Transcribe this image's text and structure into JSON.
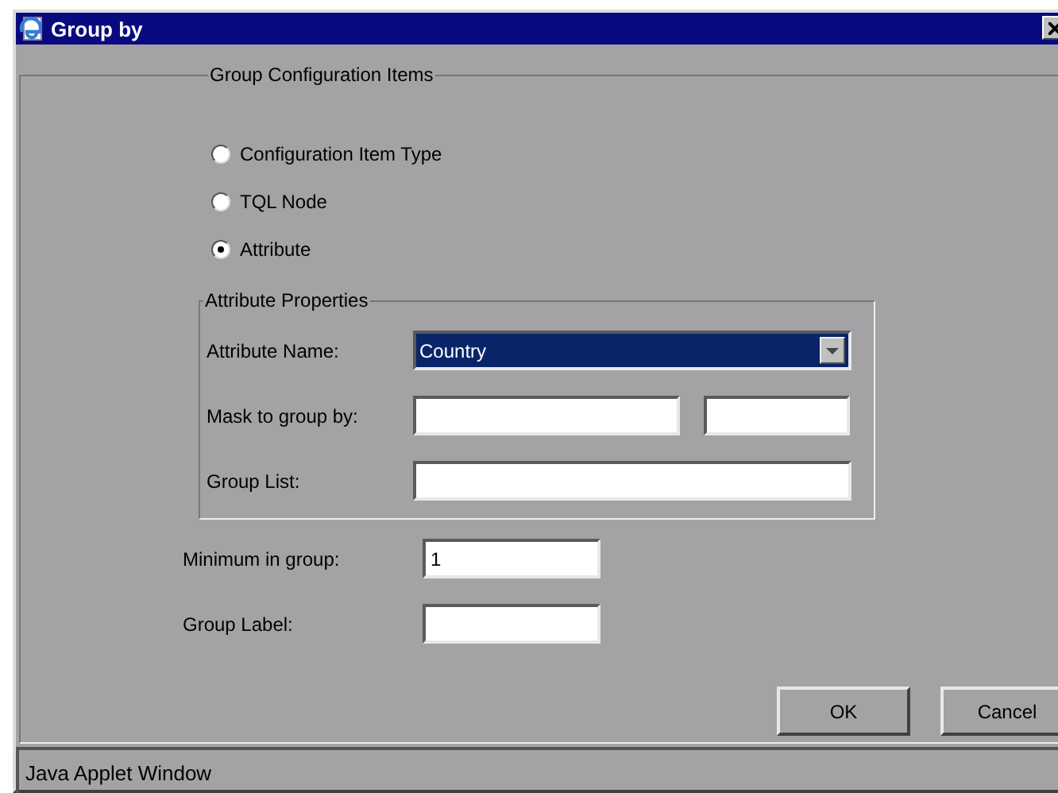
{
  "window": {
    "title": "Group by"
  },
  "group": {
    "legend": "Group Configuration Items",
    "options": [
      {
        "label": "Configuration Item Type",
        "selected": false
      },
      {
        "label": "TQL Node",
        "selected": false
      },
      {
        "label": "Attribute",
        "selected": true
      }
    ],
    "attribute_properties": {
      "legend": "Attribute Properties",
      "attribute_name": {
        "label": "Attribute Name:",
        "value": "Country"
      },
      "mask": {
        "label": "Mask to group by:"
      },
      "group_list": {
        "label": "Group List:"
      }
    },
    "minimum_in_group": {
      "label": "Minimum in group:",
      "value": "1"
    },
    "group_label": {
      "label": "Group Label:"
    }
  },
  "buttons": [
    "OK",
    "Cancel"
  ],
  "status_bar": "Java Applet Window"
}
